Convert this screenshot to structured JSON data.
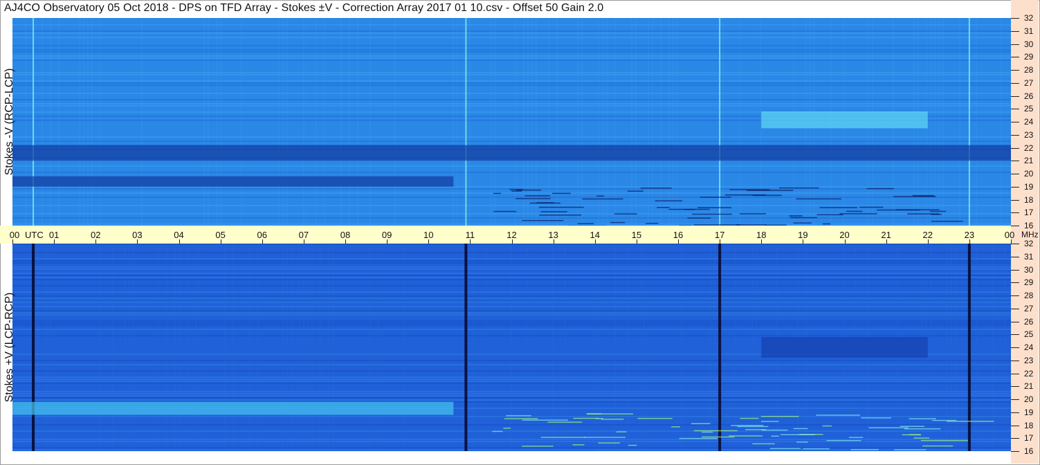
{
  "title": "AJ4CO Observatory  05 Oct 2018  -  DPS on TFD Array  -  Stokes ±V  -  Correction Array 2017 01 10.csv  -  Offset 50  Gain 2.0",
  "panels": {
    "top": {
      "ylabel": "Stokes -V (RCP-LCP)"
    },
    "bottom": {
      "ylabel": "Stokes +V (LCP-RCP)"
    }
  },
  "axis": {
    "utc_label": "UTC",
    "freq_unit": "MHz"
  },
  "colors": {
    "background": "#2a7de0",
    "axis_band": "#ffffcc",
    "right_strip": "#fde0cc"
  },
  "chart_data": {
    "type": "heatmap",
    "x_label": "UTC",
    "x_ticks": [
      "00",
      "01",
      "02",
      "03",
      "04",
      "05",
      "06",
      "07",
      "08",
      "09",
      "10",
      "11",
      "12",
      "13",
      "14",
      "15",
      "16",
      "17",
      "18",
      "19",
      "20",
      "21",
      "22",
      "23",
      "00"
    ],
    "xlim_hours": [
      0,
      24
    ],
    "y_unit": "MHz",
    "y_ticks": [
      16,
      17,
      18,
      19,
      20,
      21,
      22,
      23,
      24,
      25,
      26,
      27,
      28,
      29,
      30,
      31,
      32
    ],
    "ylim_mhz": [
      16,
      32
    ],
    "panels": [
      {
        "name": "Stokes -V (RCP-LCP)",
        "features": [
          {
            "type": "bright-vline",
            "hour": 10.9
          },
          {
            "type": "bright-vline",
            "hour": 17.0
          },
          {
            "type": "bright-vline",
            "hour": 23.0
          },
          {
            "type": "bright-vline",
            "hour": 0.5
          },
          {
            "type": "dark-band",
            "mhz": [
              19.0,
              19.8
            ],
            "hours": [
              0,
              10.6
            ]
          },
          {
            "type": "dark-band",
            "mhz": [
              21.0,
              22.2
            ],
            "hours": [
              0,
              24
            ]
          },
          {
            "type": "bright-block",
            "mhz": [
              23.5,
              24.8
            ],
            "hours": [
              18,
              22
            ]
          }
        ]
      },
      {
        "name": "Stokes +V (LCP-RCP)",
        "features": [
          {
            "type": "dark-vline",
            "hour": 17.0
          },
          {
            "type": "dark-vline",
            "hour": 23.0
          },
          {
            "type": "dark-vline",
            "hour": 0.5
          },
          {
            "type": "dark-vline",
            "hour": 10.9
          },
          {
            "type": "bright-band",
            "mhz": [
              18.8,
              19.8
            ],
            "hours": [
              0,
              10.6
            ]
          },
          {
            "type": "dark-block",
            "mhz": [
              23.2,
              24.8
            ],
            "hours": [
              18,
              22
            ]
          }
        ]
      }
    ]
  }
}
